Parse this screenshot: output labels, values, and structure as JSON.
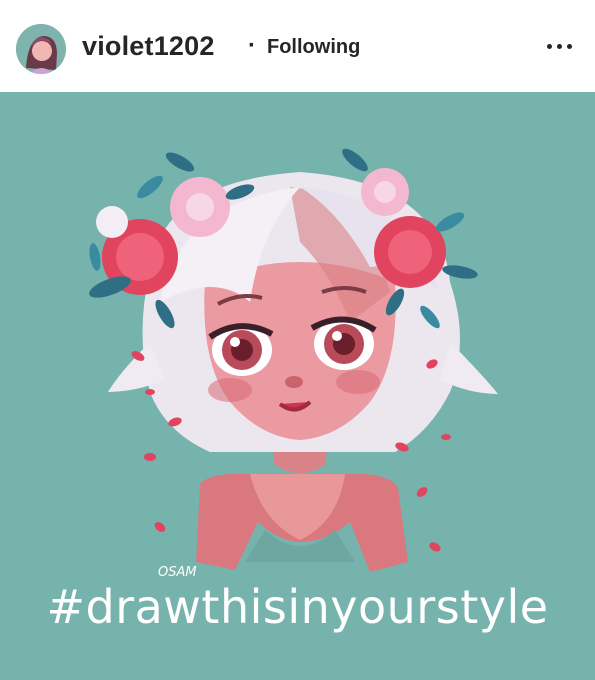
{
  "header": {
    "username": "violet1202",
    "separator": "·",
    "follow_status": "Following",
    "avatar_icon": "user-avatar-icon",
    "more_icon": "more-options-icon"
  },
  "post": {
    "background_color": "#76b3ad",
    "signature": "OSAM",
    "caption": "#drawthisinyourstyle"
  }
}
